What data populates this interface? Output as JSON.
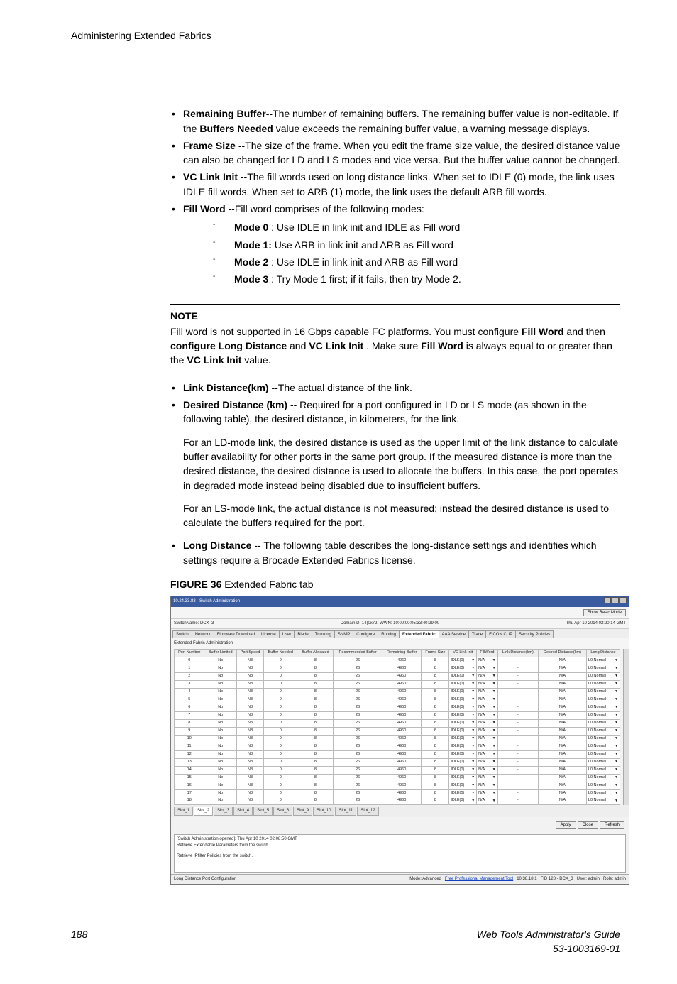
{
  "header": "Administering Extended Fabrics",
  "bullets_top": [
    {
      "term": "Remaining Buffer",
      "desc": "--The number of remaining buffers. The remaining buffer value is non-editable. If the ",
      "bold2": "Buffers Needed",
      "desc2": " value exceeds the remaining buffer value, a warning message displays."
    },
    {
      "term": "Frame Size ",
      "desc": "--The size of the frame. When you edit the frame size value, the desired distance value can also be changed for LD and LS modes and vice versa. But the buffer value cannot be changed."
    },
    {
      "term": "VC Link Init ",
      "desc": "--The fill words used on long distance links. When set to IDLE (0) mode, the link uses IDLE fill words. When set to ARB (1) mode, the link uses the default ARB fill words."
    },
    {
      "term": "Fill Word ",
      "desc": "--Fill word comprises of the following modes:"
    }
  ],
  "modes": [
    {
      "label": "Mode 0",
      "desc": " : Use IDLE in link init and IDLE as Fill word"
    },
    {
      "label": "Mode 1:",
      "desc": " Use ARB in link init and ARB as Fill word"
    },
    {
      "label": "Mode 2",
      "desc": " : Use IDLE in link init and ARB as Fill word"
    },
    {
      "label": "Mode 3",
      "desc": " : Try Mode 1 first; if it fails, then try Mode 2."
    }
  ],
  "note": {
    "label": "NOTE",
    "p1a": "Fill word is not supported in 16 Gbps capable FC platforms. You must configure ",
    "b1": "Fill Word",
    "p1b": " and then ",
    "b2": "configure Long Distance",
    "p1c": " and ",
    "b3": "VC Link Init",
    "p1d": " . Make sure ",
    "b4": "Fill Word",
    "p1e": " is always equal to or greater than the ",
    "b5": "VC Link Init",
    "p1f": " value."
  },
  "bullets_mid": [
    {
      "term": "Link Distance(km) ",
      "desc": "--The actual distance of the link."
    },
    {
      "term": "Desired Distance (km)",
      "desc": " -- Required for a port configured in LD or LS mode (as shown in the following table), the desired distance, in kilometers, for the link."
    }
  ],
  "para1": "For an LD-mode link, the desired distance is used as the upper limit of the link distance to calculate buffer availability for other ports in the same port group. If the measured distance is more than the desired distance, the desired distance is used to allocate the buffers. In this case, the port operates in degraded mode instead being disabled due to insufficient buffers.",
  "para2": "For an LS-mode link, the actual distance is not measured; instead the desired distance is used to calculate the buffers required for the port.",
  "bullets_last": [
    {
      "term": "Long Distance",
      "desc": " -- The following table describes the long-distance settings and identifies which settings require a Brocade Extended Fabrics license."
    }
  ],
  "figure": {
    "label": "FIGURE 36",
    "caption": " Extended Fabric tab"
  },
  "ss": {
    "title": "10.24.33.83 - Switch Administration",
    "show_basic": "Show Basic Mode",
    "switchname_key": "SwitchName:",
    "switchname_val": "DCX_3",
    "domainid": "DomainID: 14(0x72)   WWN: 10:00:00:05:33:40:29:00",
    "timestamp": "Thu Apr 10 2014 02:20:14 GMT",
    "tabs": [
      "Switch",
      "Network",
      "Firmware Download",
      "License",
      "User",
      "Blade",
      "Trunking",
      "SNMP",
      "Configure",
      "Routing",
      "Extended Fabric",
      "AAA Service",
      "Trace",
      "FICON CUP",
      "Security Policies"
    ],
    "active_tab": "Extended Fabric",
    "section": "Extended Fabric Administration",
    "cols": [
      "Port Number",
      "Buffer Limited",
      "Port Speed",
      "Buffer Needed",
      "Buffer Allocated",
      "Recommended Buffer",
      "Remaining Buffer",
      "Frame Size",
      "VC Link Init",
      "FillWord",
      "Link Distance(km)",
      "Desired Distance(km)",
      "Long Distance"
    ],
    "rows": [
      [
        "0",
        "No",
        "N8",
        "0",
        "8",
        "26",
        "4960",
        "8",
        "IDLE(0)",
        "N/A",
        "-",
        "N/A",
        "L0:Normal"
      ],
      [
        "1",
        "No",
        "N8",
        "0",
        "8",
        "26",
        "4960",
        "8",
        "IDLE(0)",
        "N/A",
        "-",
        "N/A",
        "L0:Normal"
      ],
      [
        "2",
        "No",
        "N8",
        "0",
        "8",
        "26",
        "4960",
        "8",
        "IDLE(0)",
        "N/A",
        "-",
        "N/A",
        "L0:Normal"
      ],
      [
        "3",
        "No",
        "N8",
        "0",
        "8",
        "26",
        "4960",
        "8",
        "IDLE(0)",
        "N/A",
        "-",
        "N/A",
        "L0:Normal"
      ],
      [
        "4",
        "No",
        "N8",
        "0",
        "8",
        "26",
        "4960",
        "8",
        "IDLE(0)",
        "N/A",
        "-",
        "N/A",
        "L0:Normal"
      ],
      [
        "5",
        "No",
        "N8",
        "0",
        "8",
        "26",
        "4960",
        "8",
        "IDLE(0)",
        "N/A",
        "-",
        "N/A",
        "L0:Normal"
      ],
      [
        "6",
        "No",
        "N8",
        "0",
        "8",
        "26",
        "4960",
        "8",
        "IDLE(0)",
        "N/A",
        "-",
        "N/A",
        "L0:Normal"
      ],
      [
        "7",
        "No",
        "N8",
        "0",
        "8",
        "26",
        "4960",
        "8",
        "IDLE(0)",
        "N/A",
        "-",
        "N/A",
        "L0:Normal"
      ],
      [
        "8",
        "No",
        "N8",
        "0",
        "8",
        "26",
        "4960",
        "8",
        "IDLE(0)",
        "N/A",
        "-",
        "N/A",
        "L0:Normal"
      ],
      [
        "9",
        "No",
        "N8",
        "0",
        "8",
        "26",
        "4960",
        "8",
        "IDLE(0)",
        "N/A",
        "-",
        "N/A",
        "L0:Normal"
      ],
      [
        "10",
        "No",
        "N8",
        "0",
        "8",
        "26",
        "4960",
        "8",
        "IDLE(0)",
        "N/A",
        "-",
        "N/A",
        "L0:Normal"
      ],
      [
        "11",
        "No",
        "N8",
        "0",
        "8",
        "26",
        "4960",
        "8",
        "IDLE(0)",
        "N/A",
        "-",
        "N/A",
        "L0:Normal"
      ],
      [
        "12",
        "No",
        "N8",
        "0",
        "8",
        "26",
        "4960",
        "8",
        "IDLE(0)",
        "N/A",
        "-",
        "N/A",
        "L0:Normal"
      ],
      [
        "13",
        "No",
        "N8",
        "0",
        "8",
        "26",
        "4960",
        "8",
        "IDLE(0)",
        "N/A",
        "-",
        "N/A",
        "L0:Normal"
      ],
      [
        "14",
        "No",
        "N8",
        "0",
        "8",
        "26",
        "4960",
        "8",
        "IDLE(0)",
        "N/A",
        "-",
        "N/A",
        "L0:Normal"
      ],
      [
        "15",
        "No",
        "N8",
        "0",
        "8",
        "26",
        "4960",
        "8",
        "IDLE(0)",
        "N/A",
        "-",
        "N/A",
        "L0:Normal"
      ],
      [
        "16",
        "No",
        "N8",
        "0",
        "8",
        "26",
        "4960",
        "8",
        "IDLE(0)",
        "N/A",
        "-",
        "N/A",
        "L0:Normal"
      ],
      [
        "17",
        "No",
        "N8",
        "0",
        "8",
        "26",
        "4960",
        "8",
        "IDLE(0)",
        "N/A",
        "-",
        "N/A",
        "L0:Normal"
      ],
      [
        "18",
        "No",
        "N8",
        "0",
        "8",
        "26",
        "4960",
        "8",
        "IDLE(0)",
        "N/A",
        "-",
        "N/A",
        "L0:Normal"
      ]
    ],
    "slot_tabs": [
      "Slot_1",
      "Slot_2",
      "Slot_3",
      "Slot_4",
      "Slot_5",
      "Slot_6",
      "Slot_9",
      "Slot_10",
      "Slot_11",
      "Slot_12"
    ],
    "active_slot": "Slot_2",
    "buttons": [
      "Apply",
      "Close",
      "Refresh"
    ],
    "log1": "[Switch Administration opened]: Thu Apr 10 2014 02:08:50 GMT",
    "log2": "Retrieve Extendable Parameters  from the switch.",
    "log3": "Retrieve IPfilter Policies from the switch.",
    "status_left": "Long Distance Port Configuration",
    "status_mode": "Mode: Advanced",
    "status_link": "Free Professional Management Tool",
    "status_ip": "10.38.18.1",
    "status_fid": "FID 128 - DCX_3",
    "status_user": "User: admin",
    "status_role": "Role: admin"
  },
  "footer": {
    "page": "188",
    "guide": "Web Tools Administrator's Guide",
    "docnum": "53-1003169-01"
  }
}
